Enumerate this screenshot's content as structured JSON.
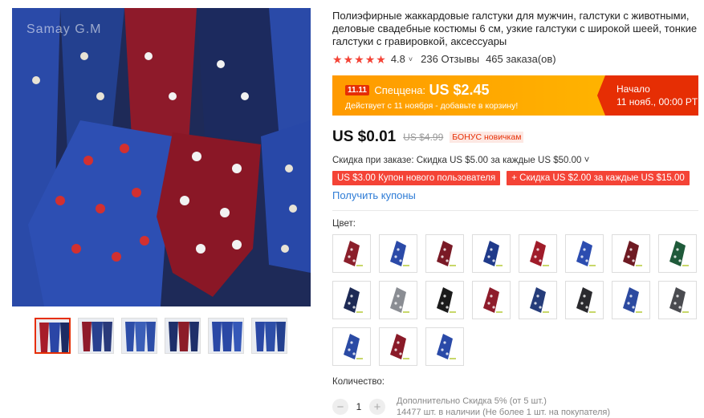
{
  "gallery": {
    "watermark": "Samay G.M",
    "main_image_alt": "ties",
    "thumbnails": [
      {
        "colors": [
          "#a71c2a",
          "#2a46a6",
          "#1d2c63"
        ],
        "active": true
      },
      {
        "colors": [
          "#8f1a2a",
          "#28408f",
          "#2a3a7a"
        ],
        "active": false
      },
      {
        "colors": [
          "#2d4ea8",
          "#3b5fb8",
          "#2d4ea8"
        ],
        "active": false
      },
      {
        "colors": [
          "#1e2f6a",
          "#8c1c28",
          "#1e2f6a"
        ],
        "active": false
      },
      {
        "colors": [
          "#2a48a5",
          "#2a48a5",
          "#3558b8"
        ],
        "active": false
      },
      {
        "colors": [
          "#2a48a5",
          "#2d4ea8",
          "#23408f"
        ],
        "active": false
      }
    ]
  },
  "product": {
    "title": "Полиэфирные жаккардовые галстуки для мужчин, галстуки с животными, деловые свадебные костюмы 6 см, узкие галстуки с широкой шеей, тонкие галстуки с гравировкой, аксессуары",
    "rating": "4.8",
    "rating_chevron": "˅",
    "reviews": "236 Отзывы",
    "orders": "465 заказа(ов)"
  },
  "promo": {
    "badge": "11.11",
    "label": "Спеццена:",
    "price": "US $2.45",
    "subtitle": "Действует с 11 ноября - добавьте в корзину!",
    "start_label": "Начало",
    "start_time": "11 нояб., 00:00 PT"
  },
  "pricing": {
    "current": "US $0.01",
    "old": "US $4.99",
    "bonus": "БОНУС новичкам",
    "discount_line": "Скидка при заказе: Скидка US $5.00 за каждые US $50.00 ˅",
    "coupons": [
      "US $3.00 Купон нового пользователя",
      "+ Скидка US $2.00 за каждые US $15.00"
    ],
    "get_coupons": "Получить купоны"
  },
  "color": {
    "label": "Цвет:",
    "swatches": [
      "#8b1f2b",
      "#2b4aa8",
      "#7a1a26",
      "#1f3a8a",
      "#a01c2a",
      "#2c4db0",
      "#6e1a22",
      "#1f5a3a",
      "#1d2a55",
      "#8a8d93",
      "#1b1b1b",
      "#8e1c2b",
      "#253c7a",
      "#2a2a2e",
      "#2c4aa0",
      "#4a4b50",
      "#2a4aa4",
      "#8a1a28",
      "#2a4aa8"
    ]
  },
  "quantity": {
    "label": "Количество:",
    "minus": "−",
    "value": "1",
    "plus": "+",
    "info_line1": "Дополнительно Скидка 5% (от 5 шт.)",
    "info_line2": "14477 шт. в наличии (Не более 1 шт. на покупателя)"
  }
}
